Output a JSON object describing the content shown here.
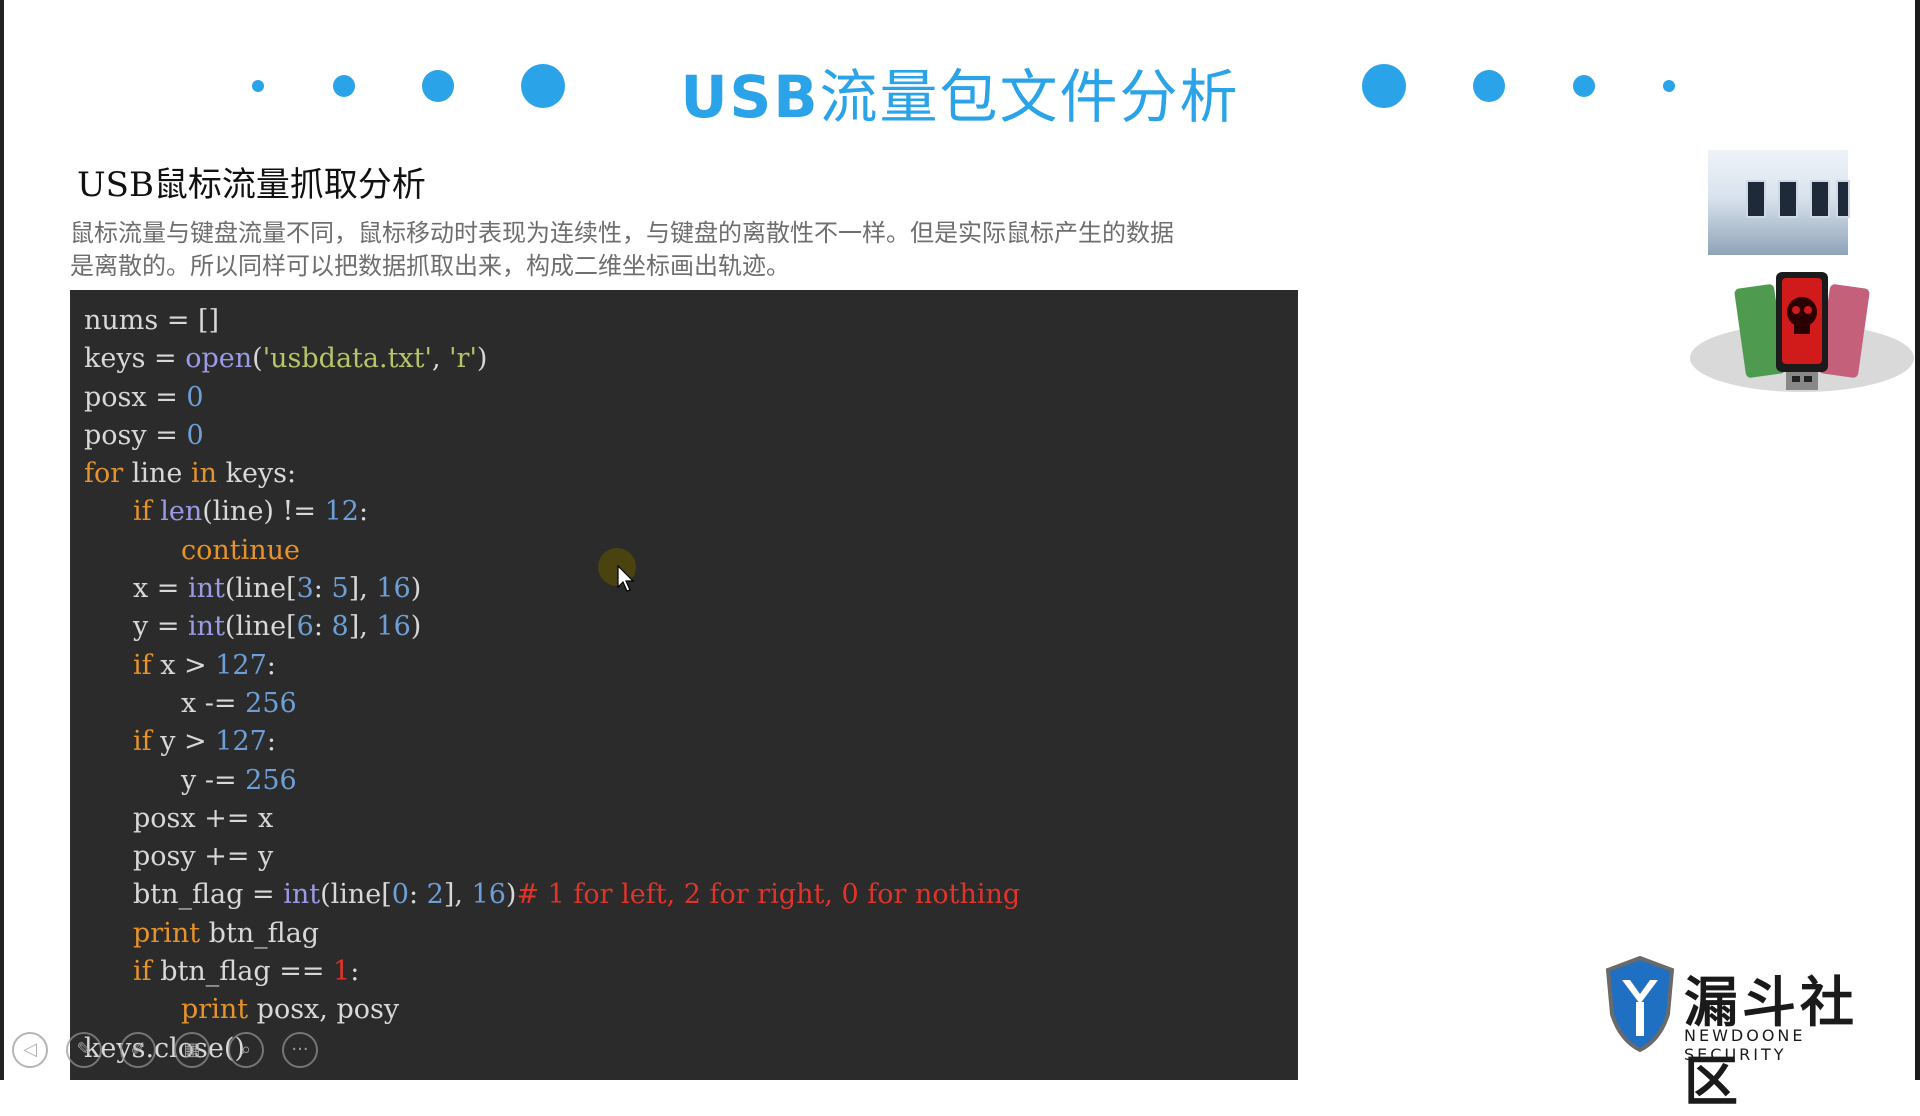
{
  "slide": {
    "title_prefix": "USB",
    "title_rest": "流量包文件分析",
    "subtitle": "USB鼠标流量抓取分析",
    "description": [
      "鼠标流量与键盘流量不同，鼠标移动时表现为连续性，与键盘的离散性不一样。但是实际鼠标产生的数据",
      "是离散的。所以同样可以把数据抓取出来，构成二维坐标画出轨迹。"
    ],
    "accent_color": "#2aa3e8"
  },
  "code": {
    "line1": "nums = []",
    "l2_a": "keys = ",
    "l2_fn": "open",
    "l2_b": "(",
    "l2_s1": "'usbdata.txt'",
    "l2_c": ", ",
    "l2_s2": "'r'",
    "l2_d": ")",
    "l3_a": "posx = ",
    "l3_n": "0",
    "l4_a": "posy = ",
    "l4_n": "0",
    "l5_kw1": "for",
    "l5_a": " line ",
    "l5_kw2": "in",
    "l5_b": " keys:",
    "l6_kw": "if",
    "l6_sp": " ",
    "l6_fn": "len",
    "l6_a": "(line) != ",
    "l6_n": "12",
    "l6_b": ":",
    "l7_kw": "continue",
    "l8_a": "x = ",
    "l8_fn": "int",
    "l8_b": "(line[",
    "l8_n1": "3",
    "l8_c": ": ",
    "l8_n2": "5",
    "l8_d": "], ",
    "l8_n3": "16",
    "l8_e": ")",
    "l9_a": "y = ",
    "l9_fn": "int",
    "l9_b": "(line[",
    "l9_n1": "6",
    "l9_c": ": ",
    "l9_n2": "8",
    "l9_d": "], ",
    "l9_n3": "16",
    "l9_e": ")",
    "l10_kw": "if",
    "l10_a": " x > ",
    "l10_n": "127",
    "l10_b": ":",
    "l11_a": "x -= ",
    "l11_n": "256",
    "l12_kw": "if",
    "l12_a": " y > ",
    "l12_n": "127",
    "l12_b": ":",
    "l13_a": "y -= ",
    "l13_n": "256",
    "l14": "posx += x",
    "l15": "posy += y",
    "l16_a": "btn_flag = ",
    "l16_fn": "int",
    "l16_b": "(line[",
    "l16_n1": "0",
    "l16_c": ": ",
    "l16_n2": "2",
    "l16_d": "], ",
    "l16_n3": "16",
    "l16_e": ")",
    "l16_cm": "# 1 for left, 2 for right, 0 for nothing",
    "l17_kw": "print",
    "l17_a": " btn_flag",
    "l18_kw": "if",
    "l18_a": " btn_flag == ",
    "l18_n": "1",
    "l18_b": ":",
    "l19_kw": "print",
    "l19_a": " posx, posy",
    "l20": "keys.close()"
  },
  "logo": {
    "name": "漏斗社区",
    "tagline": "NEWDOONE SECURITY"
  },
  "player_controls": {
    "prev_icon": "prev-arrow-icon",
    "pen_icon": "pen-icon",
    "annotate_icon": "annotate-icon",
    "slides_icon": "slides-icon",
    "zoom_icon": "zoom-icon",
    "more_icon": "more-icon",
    "more_label": "···"
  }
}
